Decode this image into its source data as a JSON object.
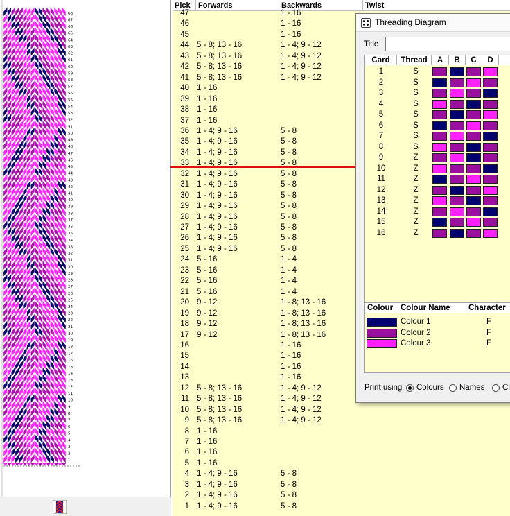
{
  "pattern": {
    "row_count": 68,
    "colors": {
      "dark": "#0a0a6e",
      "mid": "#b010b0",
      "light": "#ff22ff"
    }
  },
  "table": {
    "headers": {
      "pick": "Pick",
      "forwards": "Forwards",
      "backwards": "Backwards",
      "twist": "Twist"
    },
    "rows": [
      {
        "pick": "47",
        "fwd": "",
        "bwd": "1 - 16"
      },
      {
        "pick": "46",
        "fwd": "",
        "bwd": "1 - 16"
      },
      {
        "pick": "45",
        "fwd": "",
        "bwd": "1 - 16"
      },
      {
        "pick": "44",
        "fwd": "5 - 8; 13 - 16",
        "bwd": "1 - 4; 9 - 12"
      },
      {
        "pick": "43",
        "fwd": "5 - 8; 13 - 16",
        "bwd": "1 - 4; 9 - 12"
      },
      {
        "pick": "42",
        "fwd": "5 - 8; 13 - 16",
        "bwd": "1 - 4; 9 - 12"
      },
      {
        "pick": "41",
        "fwd": "5 - 8; 13 - 16",
        "bwd": "1 - 4; 9 - 12"
      },
      {
        "pick": "40",
        "fwd": "1 - 16",
        "bwd": ""
      },
      {
        "pick": "39",
        "fwd": "1 - 16",
        "bwd": ""
      },
      {
        "pick": "38",
        "fwd": "1 - 16",
        "bwd": ""
      },
      {
        "pick": "37",
        "fwd": "1 - 16",
        "bwd": ""
      },
      {
        "pick": "36",
        "fwd": "1 - 4; 9 - 16",
        "bwd": "5 - 8"
      },
      {
        "pick": "35",
        "fwd": "1 - 4; 9 - 16",
        "bwd": "5 - 8"
      },
      {
        "pick": "34",
        "fwd": "1 - 4; 9 - 16",
        "bwd": "5 - 8"
      },
      {
        "pick": "33",
        "fwd": "1 - 4; 9 - 16",
        "bwd": "5 - 8"
      },
      {
        "pick": "32",
        "fwd": "1 - 4; 9 - 16",
        "bwd": "5 - 8"
      },
      {
        "pick": "31",
        "fwd": "1 - 4; 9 - 16",
        "bwd": "5 - 8"
      },
      {
        "pick": "30",
        "fwd": "1 - 4; 9 - 16",
        "bwd": "5 - 8"
      },
      {
        "pick": "29",
        "fwd": "1 - 4; 9 - 16",
        "bwd": "5 - 8"
      },
      {
        "pick": "28",
        "fwd": "1 - 4; 9 - 16",
        "bwd": "5 - 8"
      },
      {
        "pick": "27",
        "fwd": "1 - 4; 9 - 16",
        "bwd": "5 - 8"
      },
      {
        "pick": "26",
        "fwd": "1 - 4; 9 - 16",
        "bwd": "5 - 8"
      },
      {
        "pick": "25",
        "fwd": "1 - 4; 9 - 16",
        "bwd": "5 - 8"
      },
      {
        "pick": "24",
        "fwd": "5 - 16",
        "bwd": "1 - 4"
      },
      {
        "pick": "23",
        "fwd": "5 - 16",
        "bwd": "1 - 4"
      },
      {
        "pick": "22",
        "fwd": "5 - 16",
        "bwd": "1 - 4"
      },
      {
        "pick": "21",
        "fwd": "5 - 16",
        "bwd": "1 - 4"
      },
      {
        "pick": "20",
        "fwd": "9 - 12",
        "bwd": "1 - 8; 13 - 16"
      },
      {
        "pick": "19",
        "fwd": "9 - 12",
        "bwd": "1 - 8; 13 - 16"
      },
      {
        "pick": "18",
        "fwd": "9 - 12",
        "bwd": "1 - 8; 13 - 16"
      },
      {
        "pick": "17",
        "fwd": "9 - 12",
        "bwd": "1 - 8; 13 - 16"
      },
      {
        "pick": "16",
        "fwd": "",
        "bwd": "1 - 16"
      },
      {
        "pick": "15",
        "fwd": "",
        "bwd": "1 - 16"
      },
      {
        "pick": "14",
        "fwd": "",
        "bwd": "1 - 16"
      },
      {
        "pick": "13",
        "fwd": "",
        "bwd": "1 - 16"
      },
      {
        "pick": "12",
        "fwd": "5 - 8; 13 - 16",
        "bwd": "1 - 4; 9 - 12"
      },
      {
        "pick": "11",
        "fwd": "5 - 8; 13 - 16",
        "bwd": "1 - 4; 9 - 12"
      },
      {
        "pick": "10",
        "fwd": "5 - 8; 13 - 16",
        "bwd": "1 - 4; 9 - 12"
      },
      {
        "pick": "9",
        "fwd": "5 - 8; 13 - 16",
        "bwd": "1 - 4; 9 - 12"
      },
      {
        "pick": "8",
        "fwd": "1 - 16",
        "bwd": ""
      },
      {
        "pick": "7",
        "fwd": "1 - 16",
        "bwd": ""
      },
      {
        "pick": "6",
        "fwd": "1 - 16",
        "bwd": ""
      },
      {
        "pick": "5",
        "fwd": "1 - 16",
        "bwd": ""
      },
      {
        "pick": "4",
        "fwd": "1 - 4; 9 - 16",
        "bwd": "5 - 8"
      },
      {
        "pick": "3",
        "fwd": "1 - 4; 9 - 16",
        "bwd": "5 - 8"
      },
      {
        "pick": "2",
        "fwd": "1 - 4; 9 - 16",
        "bwd": "5 - 8"
      },
      {
        "pick": "1",
        "fwd": "1 - 4; 9 - 16",
        "bwd": "5 - 8"
      }
    ]
  },
  "threading": {
    "window_title": "Threading Diagram",
    "title_label": "Title",
    "title_value": "",
    "card_headers": {
      "card": "Card",
      "thread": "Thread",
      "a": "A",
      "b": "B",
      "c": "C",
      "d": "D"
    },
    "cards": [
      {
        "card": "1",
        "thread": "S",
        "colors": [
          "#9a0fa0",
          "#00006e",
          "#9a0fa0",
          "#ff22ff"
        ]
      },
      {
        "card": "2",
        "thread": "S",
        "colors": [
          "#00006e",
          "#9a0fa0",
          "#ff22ff",
          "#9a0fa0"
        ]
      },
      {
        "card": "3",
        "thread": "S",
        "colors": [
          "#9a0fa0",
          "#ff22ff",
          "#9a0fa0",
          "#00006e"
        ]
      },
      {
        "card": "4",
        "thread": "S",
        "colors": [
          "#ff22ff",
          "#9a0fa0",
          "#00006e",
          "#9a0fa0"
        ]
      },
      {
        "card": "5",
        "thread": "S",
        "colors": [
          "#9a0fa0",
          "#00006e",
          "#9a0fa0",
          "#ff22ff"
        ]
      },
      {
        "card": "6",
        "thread": "S",
        "colors": [
          "#00006e",
          "#9a0fa0",
          "#ff22ff",
          "#9a0fa0"
        ]
      },
      {
        "card": "7",
        "thread": "S",
        "colors": [
          "#9a0fa0",
          "#ff22ff",
          "#9a0fa0",
          "#00006e"
        ]
      },
      {
        "card": "8",
        "thread": "S",
        "colors": [
          "#ff22ff",
          "#9a0fa0",
          "#00006e",
          "#9a0fa0"
        ]
      },
      {
        "card": "9",
        "thread": "Z",
        "colors": [
          "#9a0fa0",
          "#ff22ff",
          "#00006e",
          "#9a0fa0"
        ]
      },
      {
        "card": "10",
        "thread": "Z",
        "colors": [
          "#ff22ff",
          "#9a0fa0",
          "#9a0fa0",
          "#00006e"
        ]
      },
      {
        "card": "11",
        "thread": "Z",
        "colors": [
          "#00006e",
          "#9a0fa0",
          "#ff22ff",
          "#9a0fa0"
        ]
      },
      {
        "card": "12",
        "thread": "Z",
        "colors": [
          "#9a0fa0",
          "#00006e",
          "#9a0fa0",
          "#ff22ff"
        ]
      },
      {
        "card": "13",
        "thread": "Z",
        "colors": [
          "#ff22ff",
          "#9a0fa0",
          "#00006e",
          "#9a0fa0"
        ]
      },
      {
        "card": "14",
        "thread": "Z",
        "colors": [
          "#9a0fa0",
          "#ff22ff",
          "#9a0fa0",
          "#00006e"
        ]
      },
      {
        "card": "15",
        "thread": "Z",
        "colors": [
          "#00006e",
          "#9a0fa0",
          "#ff22ff",
          "#9a0fa0"
        ]
      },
      {
        "card": "16",
        "thread": "Z",
        "colors": [
          "#9a0fa0",
          "#00006e",
          "#9a0fa0",
          "#ff22ff"
        ]
      }
    ],
    "colour_headers": {
      "colour": "Colour",
      "name": "Colour Name",
      "character": "Character"
    },
    "colours": [
      {
        "hex": "#00006e",
        "name": "Colour 1",
        "char": "F"
      },
      {
        "hex": "#9a0fa0",
        "name": "Colour 2",
        "char": "F"
      },
      {
        "hex": "#ff22ff",
        "name": "Colour 3",
        "char": "F"
      }
    ],
    "print": {
      "label": "Print using",
      "options": [
        "Colours",
        "Names",
        "Ch"
      ],
      "selected": "Colours"
    }
  }
}
